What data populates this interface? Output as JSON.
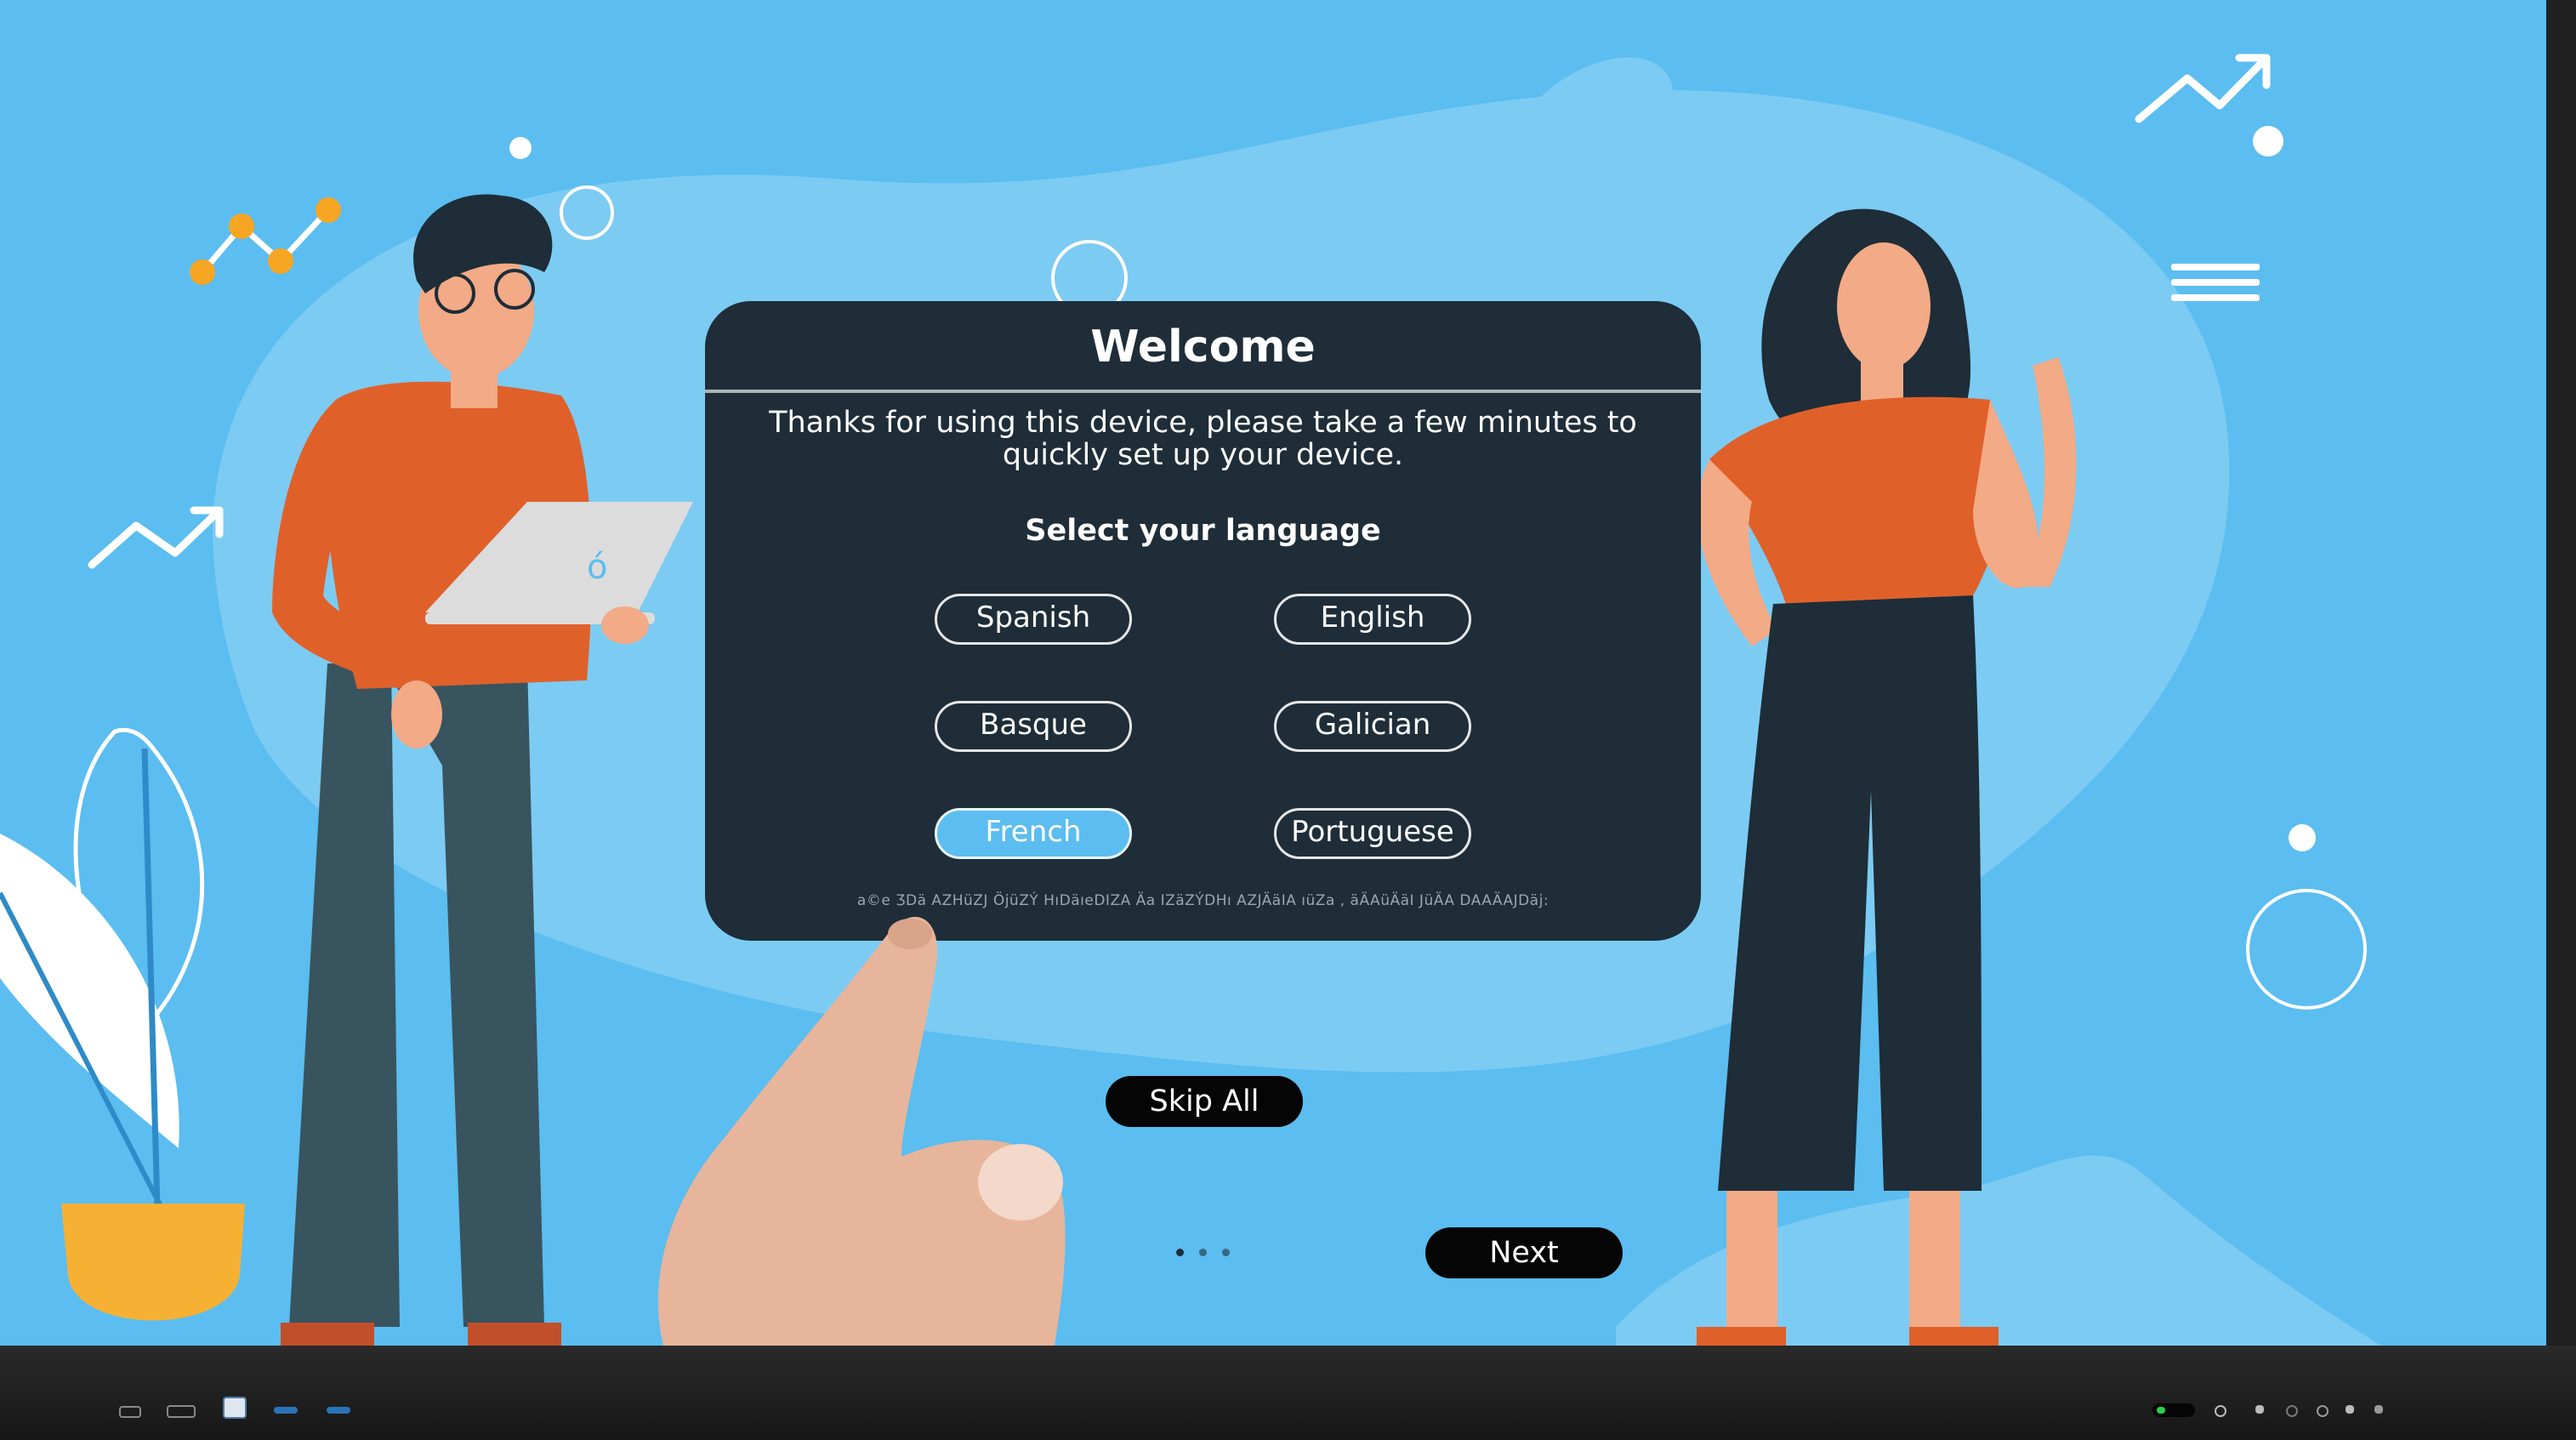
{
  "dialog": {
    "title": "Welcome",
    "message": "Thanks for using this device, please take a few minutes to quickly set up your device.",
    "language_heading": "Select your language",
    "languages": [
      "Spanish",
      "English",
      "Basque",
      "Galician",
      "French",
      "Portuguese"
    ],
    "selected_language": "French",
    "footnote": "a©e ƷDä AZHüZJ ÖjüZÝ HıDäıeDIZA Äa IZäZÝDHı AZJÄäIA ıüZa , äÄAüÄäI JüÄA DAAÄAJDäj:"
  },
  "actions": {
    "skip_all": "Skip All",
    "next": "Next"
  },
  "pagination": {
    "pages": 3,
    "current": 1
  },
  "colors": {
    "screen_background": "#5bbdf0",
    "dialog_background": "#1e2d38",
    "selected_accent": "#5bbdf0",
    "button_dark": "#050505"
  },
  "icons": [
    "trend-up-icon",
    "menu-lines-icon",
    "power-led-icon"
  ]
}
